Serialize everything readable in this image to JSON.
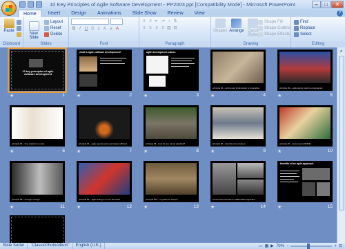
{
  "window": {
    "title": "10 Key Principles of Agile Software Development - PP2003.ppt [Compatibility Mode] - Microsoft PowerPoint",
    "minimize": "–",
    "maximize": "□",
    "close": "✕"
  },
  "tabs": [
    "Home",
    "Insert",
    "Design",
    "Animations",
    "Slide Show",
    "Review",
    "View"
  ],
  "help": "?",
  "ribbon": {
    "clipboard": {
      "label": "Clipboard",
      "paste": "Paste"
    },
    "slides": {
      "label": "Slides",
      "new_slide": "New Slide",
      "layout": "Layout",
      "reset": "Reset",
      "delete": "Delete"
    },
    "font": {
      "label": "Font"
    },
    "paragraph": {
      "label": "Paragraph"
    },
    "drawing": {
      "label": "Drawing",
      "shapes": "Shapes",
      "arrange": "Arrange",
      "quick_styles": "Quick Styles",
      "shape_fill": "Shape Fill",
      "shape_outline": "Shape Outline",
      "shape_effects": "Shape Effects"
    },
    "editing": {
      "label": "Editing",
      "find": "Find",
      "replace": "Replace",
      "select": "Select"
    }
  },
  "slides": [
    {
      "num": "1",
      "title": "10 key principles of agile software development",
      "caption": ""
    },
    {
      "num": "2",
      "title": "what is agile software development?",
      "caption": ""
    },
    {
      "num": "3",
      "title": "agile development values",
      "caption": ""
    },
    {
      "num": "4",
      "title": "",
      "caption": "principle #1 – active user involvement is imperative"
    },
    {
      "num": "5",
      "title": "",
      "caption": "principle #2 – agile teams must be empowered"
    },
    {
      "num": "6",
      "title": "",
      "caption": "principle #3 – time waits for no man"
    },
    {
      "num": "7",
      "title": "",
      "caption": "principle #4 – agile requirements are barely sufficient"
    },
    {
      "num": "8",
      "title": "",
      "caption": "principle #5 – how do you eat an elephant?"
    },
    {
      "num": "9",
      "title": "",
      "caption": "principle #6 – fast but not so furious"
    },
    {
      "num": "10",
      "title": "",
      "caption": "principle #7 – done means DONE!"
    },
    {
      "num": "11",
      "title": "",
      "caption": "principle #8 – enough, enough"
    },
    {
      "num": "12",
      "title": "",
      "caption": "principle #9 – agile testing is not for dummies"
    },
    {
      "num": "13",
      "title": "",
      "caption": "principle #10 – no place for snipers"
    },
    {
      "num": "14",
      "title": "",
      "caption": "incremental, iterative & collaborative approach"
    },
    {
      "num": "15",
      "title": "benefits of an agile approach",
      "caption": ""
    },
    {
      "num": "16",
      "title": "",
      "caption": ""
    }
  ],
  "status": {
    "view": "Slide Sorter",
    "theme": "\"ClassicPhotoAlbum\"",
    "language": "English (U.K.)",
    "zoom": "70%",
    "zoom_minus": "−",
    "zoom_plus": "+"
  },
  "icons": {
    "star": "★"
  }
}
